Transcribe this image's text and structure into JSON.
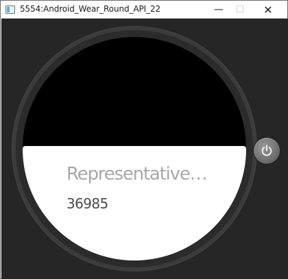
{
  "window": {
    "title": "5554:Android_Wear_Round_API_22",
    "minimize_glyph": "—",
    "maximize_glyph": "☐",
    "close_glyph": "✕"
  },
  "watch": {
    "card": {
      "title": "Representative…",
      "value": "36985"
    }
  },
  "icons": {
    "app_icon": "emulator-window-icon",
    "power_icon": "power-icon"
  },
  "colors": {
    "background": "#262626",
    "bezel": "#3b3b3b",
    "screen_top": "#000000",
    "card": "#ffffff",
    "title_text": "#a8a8a8",
    "value_text": "#4a4a4a"
  }
}
